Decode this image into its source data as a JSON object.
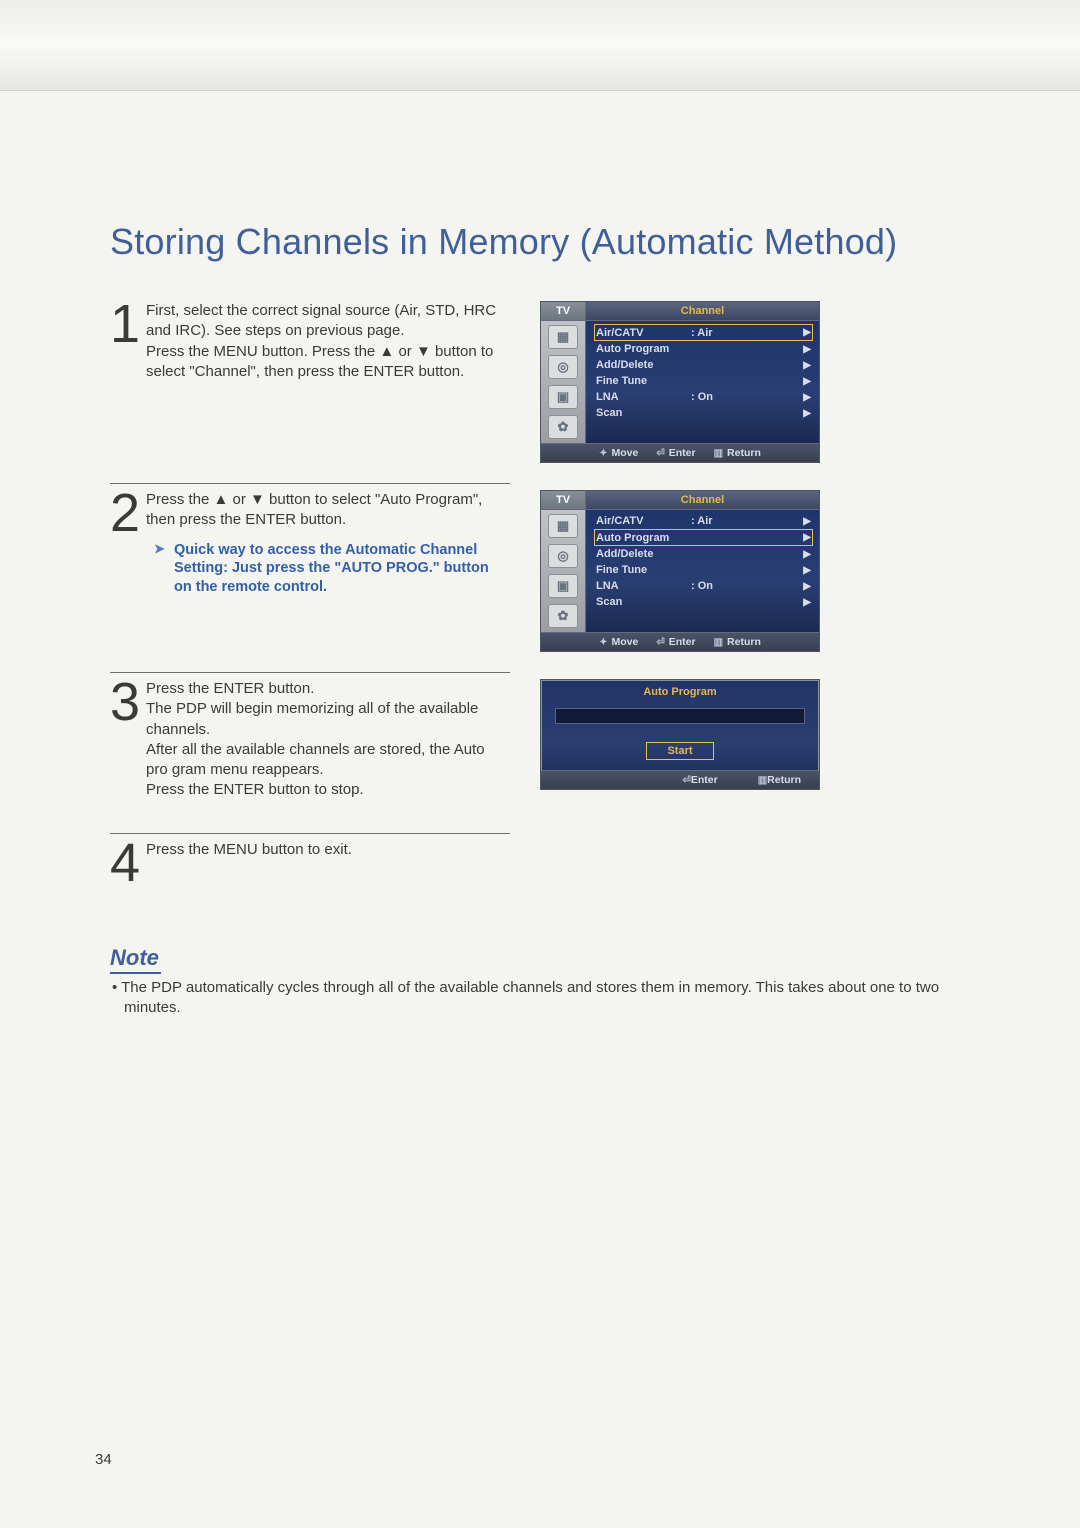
{
  "title": "Storing Channels in Memory (Automatic Method)",
  "steps": {
    "s1_num": "1",
    "s1_text": "First, select the correct signal source (Air, STD, HRC and IRC). See steps on previous page.\nPress the MENU button. Press the ▲ or ▼ button to select \"Channel\", then press the ENTER button.",
    "s2_num": "2",
    "s2_text": "Press the ▲ or ▼ button to select \"Auto Program\", then press the ENTER button.",
    "s2_tip": "Quick way to access the Automatic Channel Setting: Just press the \"AUTO PROG.\" button on the remote control.",
    "s3_num": "3",
    "s3_text": "Press the ENTER button.\nThe PDP will begin memorizing all of the available channels.\nAfter all the available channels are stored, the Auto pro gram menu reappears.\nPress the ENTER button to stop.",
    "s4_num": "4",
    "s4_text": "Press the MENU button to exit."
  },
  "osd": {
    "tv_label": "TV",
    "channel_label": "Channel",
    "items": [
      {
        "label": "Air/CATV",
        "value": ":  Air"
      },
      {
        "label": "Auto Program",
        "value": ""
      },
      {
        "label": "Add/Delete",
        "value": ""
      },
      {
        "label": "Fine Tune",
        "value": ""
      },
      {
        "label": "LNA",
        "value": ":  On"
      },
      {
        "label": "Scan",
        "value": ""
      }
    ],
    "foot_move": "Move",
    "foot_enter": "Enter",
    "foot_return": "Return"
  },
  "osd_auto": {
    "title": "Auto Program",
    "start": "Start",
    "enter": "Enter",
    "return": "Return"
  },
  "note_head": "Note",
  "note_body": "•  The PDP automatically cycles through all of the available channels and stores them in memory. This takes about one to two minutes.",
  "page_number": "34"
}
